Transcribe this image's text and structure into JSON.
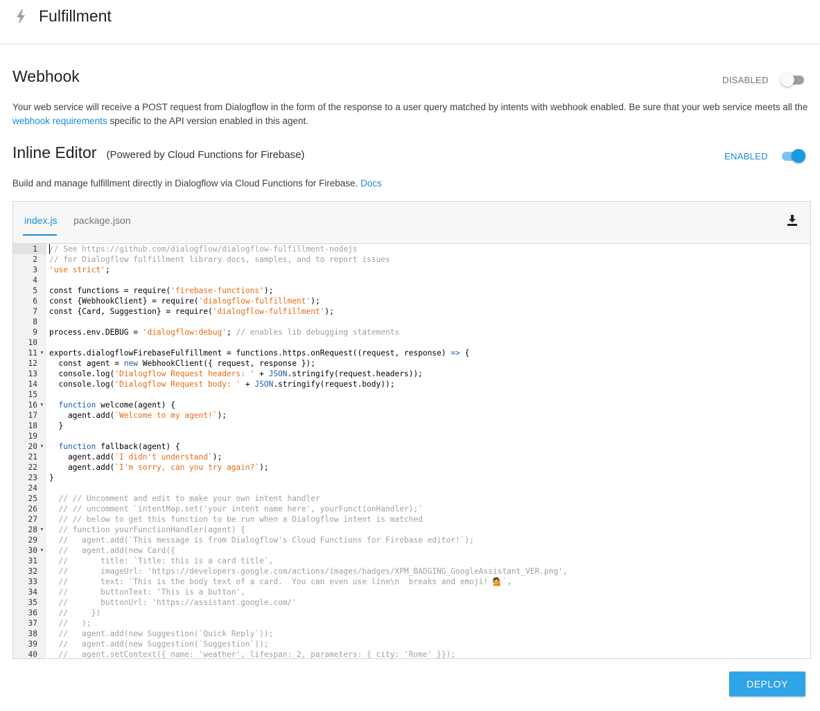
{
  "header": {
    "title": "Fulfillment",
    "icon": "lightning-bolt-icon"
  },
  "webhook": {
    "title": "Webhook",
    "status_label": "DISABLED",
    "enabled": false,
    "desc_part1": "Your web service will receive a POST request from Dialogflow in the form of the response to a user query matched by intents with webhook enabled. Be sure that your web service meets all the ",
    "link_text": "webhook requirements",
    "desc_part2": " specific to the API version enabled in this agent."
  },
  "inline_editor": {
    "title": "Inline Editor",
    "subtitle": "(Powered by Cloud Functions for Firebase)",
    "status_label": "ENABLED",
    "enabled": true,
    "desc": "Build and manage fulfillment directly in Dialogflow via Cloud Functions for Firebase. ",
    "docs_link": "Docs"
  },
  "editor": {
    "tabs": [
      {
        "label": "index.js",
        "active": true
      },
      {
        "label": "package.json",
        "active": false
      }
    ],
    "download_icon": "download-icon",
    "folded_lines": [
      11,
      16,
      20,
      28,
      30
    ],
    "lines": [
      "// See https://github.com/dialogflow/dialogflow-fulfillment-nodejs",
      "// for Dialogflow fulfillment library docs, samples, and to report issues",
      "'use strict';",
      "",
      "const functions = require('firebase-functions');",
      "const {WebhookClient} = require('dialogflow-fulfillment');",
      "const {Card, Suggestion} = require('dialogflow-fulfillment');",
      "",
      "process.env.DEBUG = 'dialogflow:debug'; // enables lib debugging statements",
      "",
      "exports.dialogflowFirebaseFulfillment = functions.https.onRequest((request, response) => {",
      "  const agent = new WebhookClient({ request, response });",
      "  console.log('Dialogflow Request headers: ' + JSON.stringify(request.headers));",
      "  console.log('Dialogflow Request body: ' + JSON.stringify(request.body));",
      "",
      "  function welcome(agent) {",
      "    agent.add(`Welcome to my agent!`);",
      "  }",
      "",
      "  function fallback(agent) {",
      "    agent.add(`I didn't understand`);",
      "    agent.add(`I'm sorry, can you try again?`);",
      "}",
      "",
      "  // // Uncomment and edit to make your own intent handler",
      "  // // uncomment `intentMap.set('your intent name here', yourFunctionHandler);`",
      "  // // below to get this function to be run when a Dialogflow intent is matched",
      "  // function yourFunctionHandler(agent) {",
      "  //   agent.add(`This message is from Dialogflow's Cloud Functions for Firebase editor!`);",
      "  //   agent.add(new Card({",
      "  //       title: `Title: this is a card title`,",
      "  //       imageUrl: 'https://developers.google.com/actions/images/badges/XPM_BADGING_GoogleAssistant_VER.png',",
      "  //       text: `This is the body text of a card.  You can even use line\\n  breaks and emoji! 💁`,",
      "  //       buttonText: 'This is a button',",
      "  //       buttonUrl: 'https://assistant.google.com/'",
      "  //     })",
      "  //   );",
      "  //   agent.add(new Suggestion(`Quick Reply`));",
      "  //   agent.add(new Suggestion(`Suggestion`));",
      "  //   agent.setContext({ name: 'weather', lifespan: 2, parameters: { city: 'Rome' }});"
    ]
  },
  "deploy_button": {
    "label": "DEPLOY"
  },
  "colors": {
    "accent": "#1a8bd6",
    "deploy": "#2fa4e7",
    "toggle_on": "#1a9ae6",
    "toggle_off": "#9e9e9e",
    "code_string": "#e86b12",
    "code_comment": "#a0a0a0",
    "code_keyword": "#1d5fa6"
  }
}
